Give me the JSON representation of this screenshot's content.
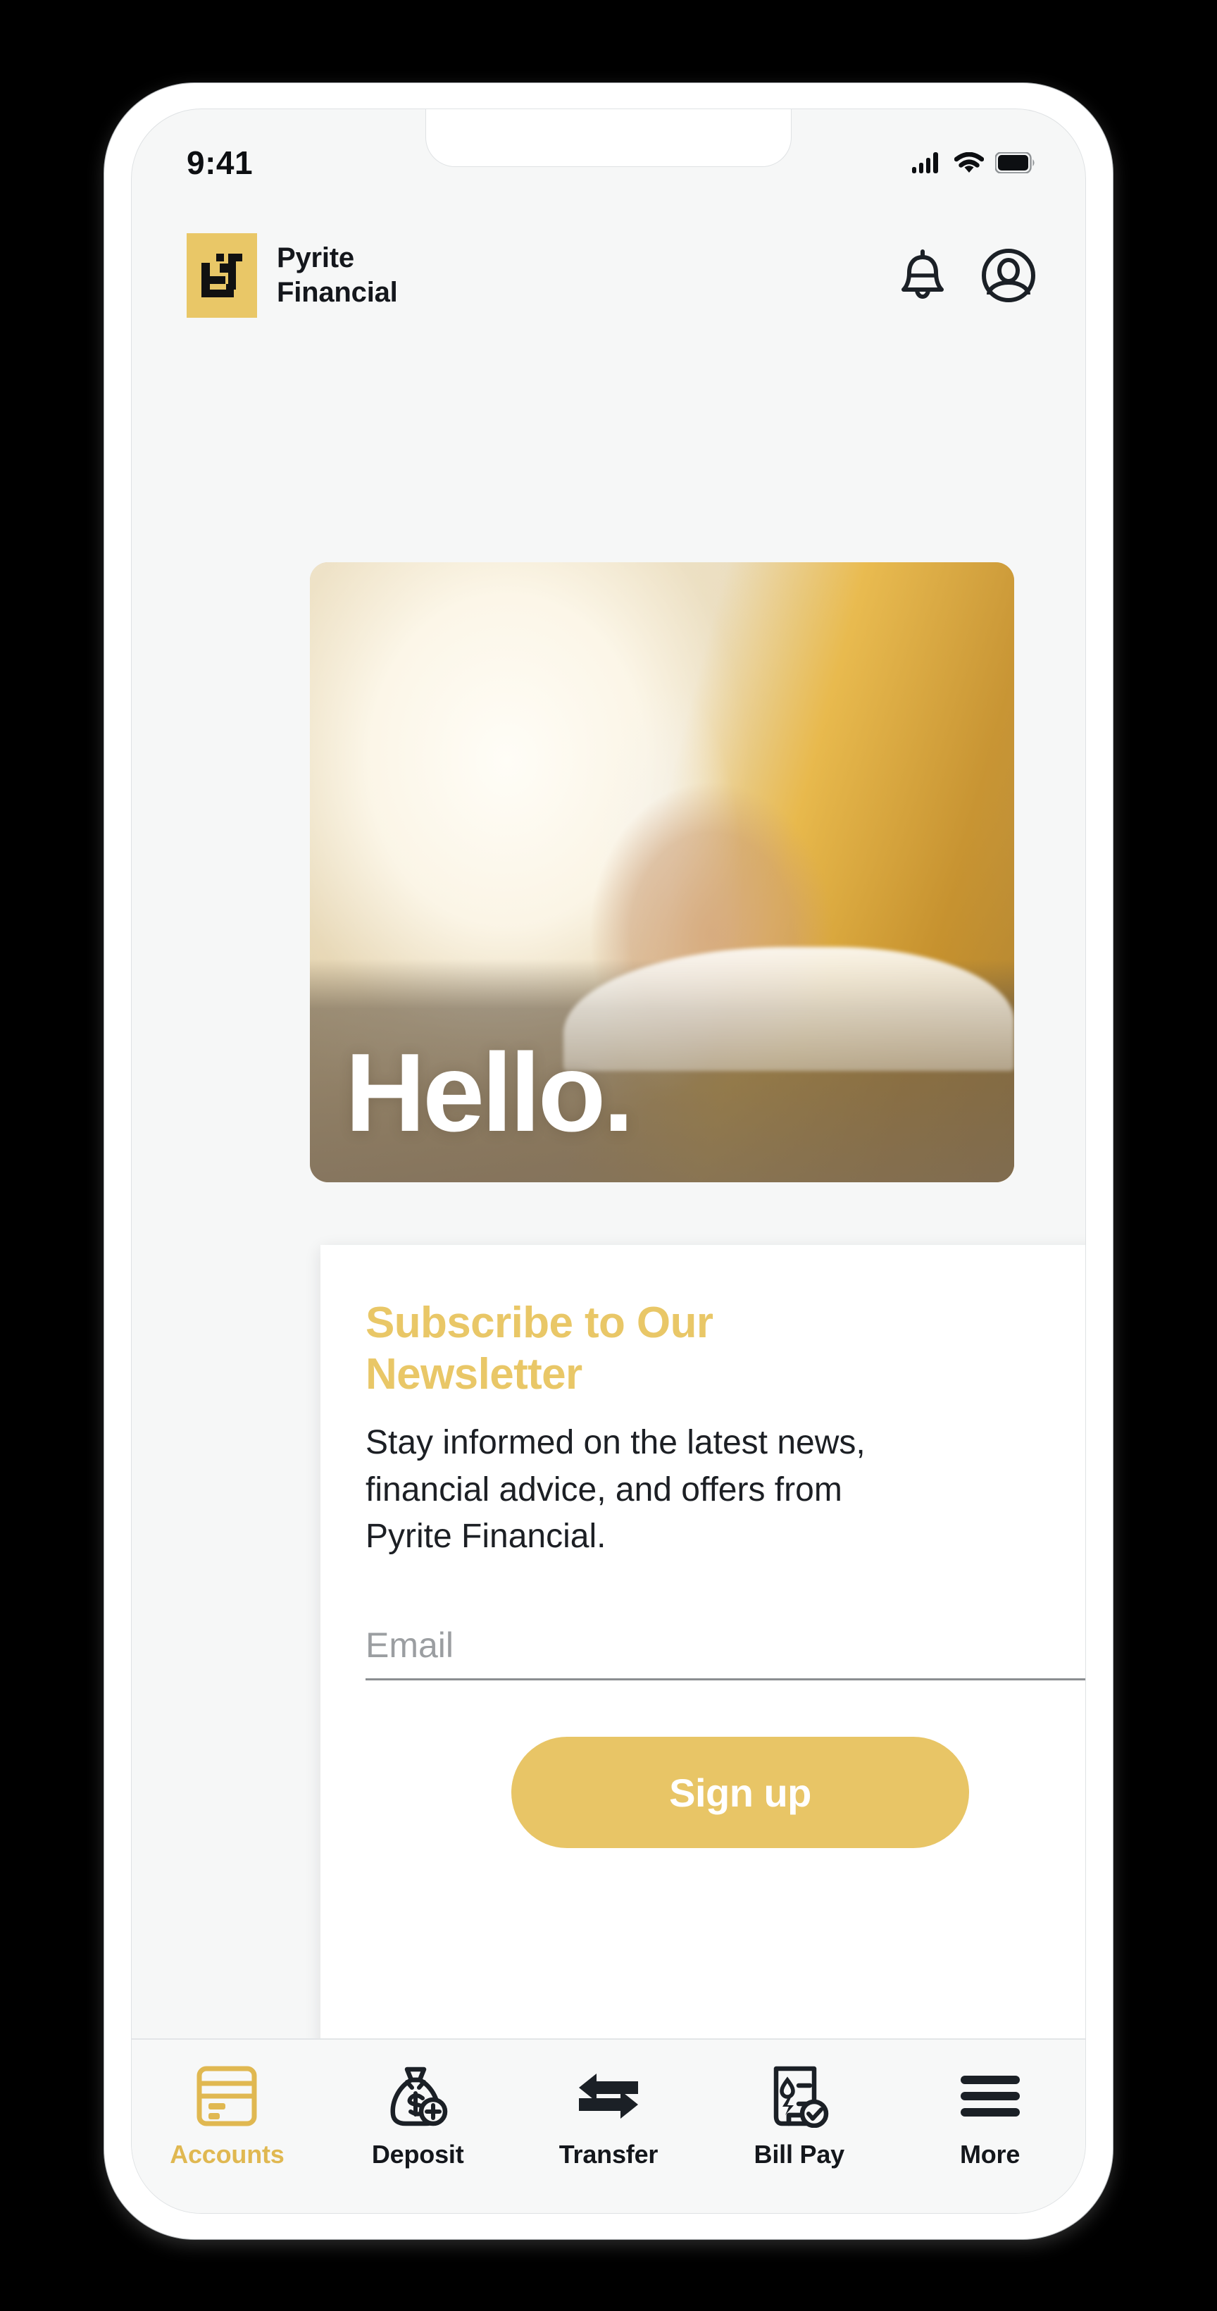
{
  "status_bar": {
    "time": "9:41",
    "icons": [
      "cellular-signal-icon",
      "wifi-icon",
      "battery-icon"
    ],
    "battery_full": true,
    "signal_bars": 4
  },
  "header": {
    "brand_name": "Pyrite\nFinancial",
    "logo_icon": "pyrite-pf-monogram-icon",
    "logo_background": "#E9C767",
    "actions": [
      {
        "name": "notifications-bell-icon",
        "label": "Notifications"
      },
      {
        "name": "user-account-icon",
        "label": "Account"
      }
    ]
  },
  "hero": {
    "title": "Hello.",
    "image_description": "hand writing with pen in notebook, warm golden light"
  },
  "newsletter": {
    "heading": "Subscribe to Our\nNewsletter",
    "body": "Stay informed on the latest news,\nfinancial advice, and offers from\nPyrite Financial.",
    "email_placeholder": "Email",
    "email_value": "",
    "signup_label": "Sign up",
    "heading_color": "#E9C767",
    "button_color": "#E8C566"
  },
  "bottom_nav": {
    "active_color": "#E0B851",
    "items": [
      {
        "label": "Accounts",
        "icon": "credit-card-icon",
        "active": true
      },
      {
        "label": "Deposit",
        "icon": "money-bag-plus-icon",
        "active": false
      },
      {
        "label": "Transfer",
        "icon": "transfer-arrows-icon",
        "active": false
      },
      {
        "label": "Bill Pay",
        "icon": "receipt-check-icon",
        "active": false
      },
      {
        "label": "More",
        "icon": "hamburger-menu-icon",
        "active": false
      }
    ]
  }
}
